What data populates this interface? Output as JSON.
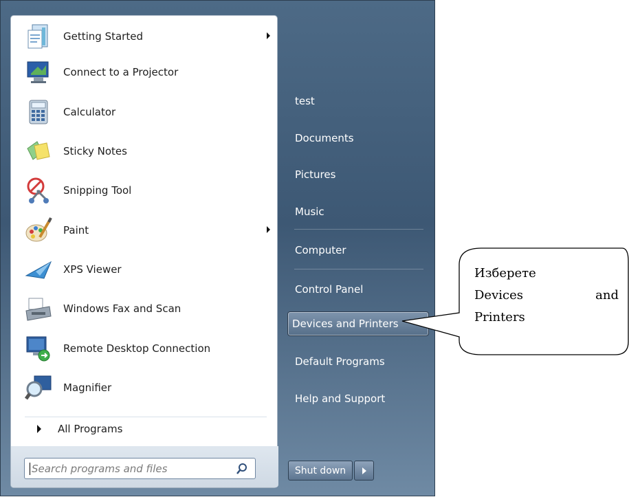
{
  "start_menu": {
    "programs": [
      {
        "label": "Getting Started",
        "icon": "getting-started-icon",
        "submenu": true
      },
      {
        "label": "Connect to a Projector",
        "icon": "projector-icon",
        "submenu": false
      },
      {
        "label": "Calculator",
        "icon": "calculator-icon",
        "submenu": false
      },
      {
        "label": "Sticky Notes",
        "icon": "sticky-notes-icon",
        "submenu": false
      },
      {
        "label": "Snipping Tool",
        "icon": "snipping-tool-icon",
        "submenu": false
      },
      {
        "label": "Paint",
        "icon": "paint-icon",
        "submenu": true
      },
      {
        "label": "XPS Viewer",
        "icon": "xps-viewer-icon",
        "submenu": false
      },
      {
        "label": "Windows Fax and Scan",
        "icon": "fax-scan-icon",
        "submenu": false
      },
      {
        "label": "Remote Desktop Connection",
        "icon": "remote-desktop-icon",
        "submenu": false
      },
      {
        "label": "Magnifier",
        "icon": "magnifier-icon",
        "submenu": false
      }
    ],
    "all_programs_label": "All Programs",
    "search_placeholder": "Search programs and files",
    "right_items": [
      {
        "label": "test"
      },
      {
        "label": "Documents"
      },
      {
        "label": "Pictures"
      },
      {
        "label": "Music"
      },
      {
        "label": "Computer"
      },
      {
        "label": "Control Panel"
      },
      {
        "label": "Devices and Printers",
        "highlighted": true
      },
      {
        "label": "Default Programs"
      },
      {
        "label": "Help and Support"
      }
    ],
    "shutdown_label": "Shut down"
  },
  "callout": {
    "line1": "Изберете",
    "line2_left": "Devices",
    "line2_right": "and",
    "line3": "Printers"
  }
}
